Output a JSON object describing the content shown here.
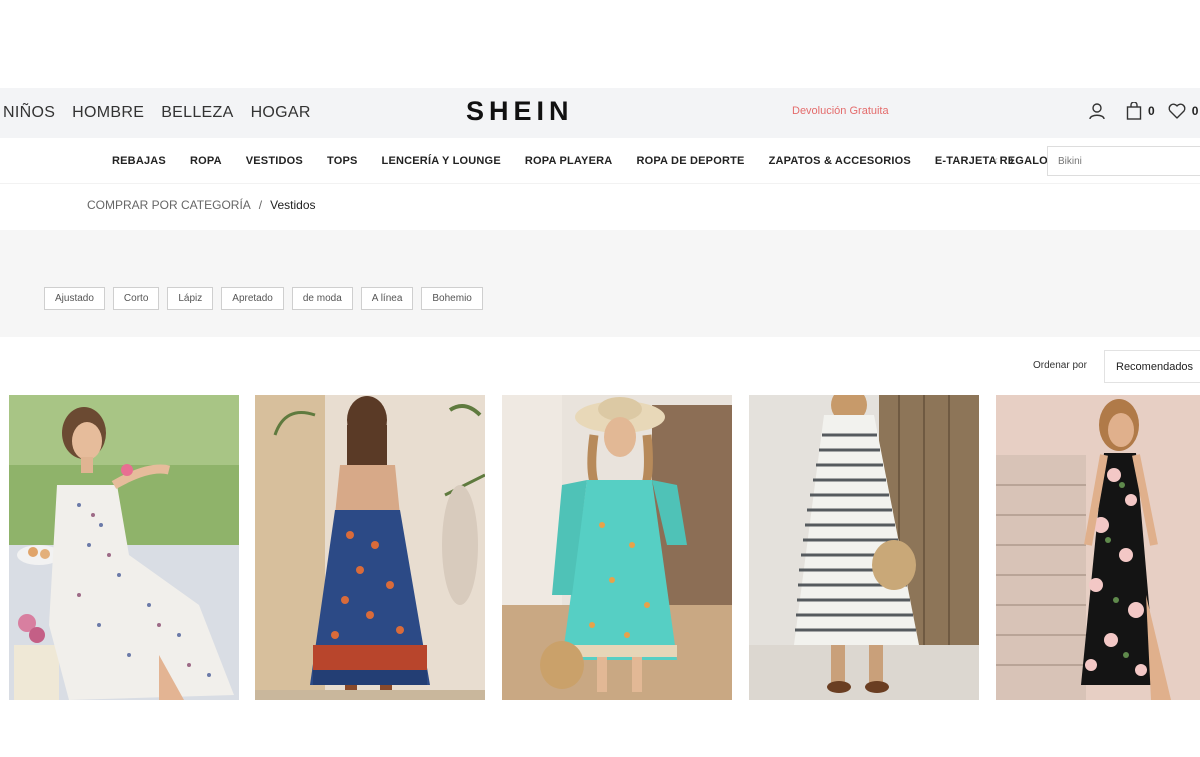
{
  "header": {
    "nav": [
      "NIÑOS",
      "HOMBRE",
      "BELLEZA",
      "HOGAR"
    ],
    "logo": "SHEIN",
    "promo": "Devolución Gratuita",
    "bag_count": "0",
    "wishlist_count": "0"
  },
  "category_nav": {
    "items": [
      "REBAJAS",
      "ROPA",
      "VESTIDOS",
      "TOPS",
      "LENCERÍA Y LOUNGE",
      "ROPA PLAYERA",
      "ROPA DE DEPORTE",
      "ZAPATOS & ACCESORIOS",
      "E-TARJETA REGALO"
    ],
    "prev_arrow": "‹",
    "next_arrow": "›",
    "search_placeholder": "Bikini"
  },
  "breadcrumb": {
    "root": "COMPRAR POR CATEGORÍA",
    "separator": "/",
    "current": "Vestidos"
  },
  "filters": [
    "Ajustado",
    "Corto",
    "Lápiz",
    "Apretado",
    "de moda",
    "A línea",
    "Bohemio"
  ],
  "sort": {
    "label": "Ordenar por",
    "value": "Recomendados"
  },
  "colors": {
    "promo": "#e46c6c",
    "topbar_bg": "#f3f4f6",
    "filter_bg": "#f6f6f6"
  },
  "icons": [
    "user-icon",
    "bag-icon",
    "heart-icon"
  ]
}
